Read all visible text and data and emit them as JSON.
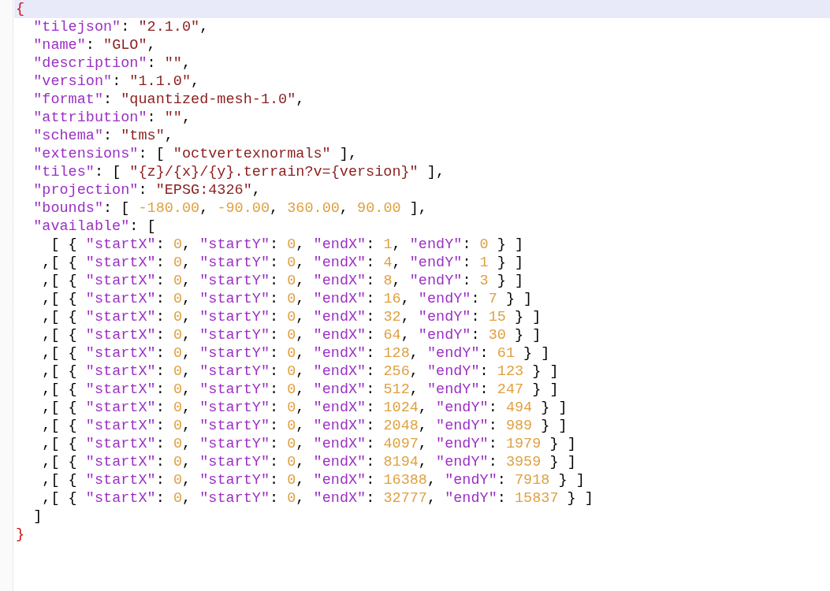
{
  "editor": {
    "lines": [
      {
        "current": true,
        "tokens": [
          {
            "kind": "brace",
            "text": "{"
          }
        ]
      },
      {
        "current": false,
        "tokens": [
          {
            "kind": "key",
            "text": "  \"tilejson\""
          },
          {
            "kind": "punct",
            "text": ": "
          },
          {
            "kind": "string",
            "text": "\"2.1.0\""
          },
          {
            "kind": "punct",
            "text": ","
          }
        ]
      },
      {
        "current": false,
        "tokens": [
          {
            "kind": "key",
            "text": "  \"name\""
          },
          {
            "kind": "punct",
            "text": ": "
          },
          {
            "kind": "string",
            "text": "\"GLO\""
          },
          {
            "kind": "punct",
            "text": ","
          }
        ]
      },
      {
        "current": false,
        "tokens": [
          {
            "kind": "key",
            "text": "  \"description\""
          },
          {
            "kind": "punct",
            "text": ": "
          },
          {
            "kind": "string",
            "text": "\"\""
          },
          {
            "kind": "punct",
            "text": ","
          }
        ]
      },
      {
        "current": false,
        "tokens": [
          {
            "kind": "key",
            "text": "  \"version\""
          },
          {
            "kind": "punct",
            "text": ": "
          },
          {
            "kind": "string",
            "text": "\"1.1.0\""
          },
          {
            "kind": "punct",
            "text": ","
          }
        ]
      },
      {
        "current": false,
        "tokens": [
          {
            "kind": "key",
            "text": "  \"format\""
          },
          {
            "kind": "punct",
            "text": ": "
          },
          {
            "kind": "string",
            "text": "\"quantized-mesh-1.0\""
          },
          {
            "kind": "punct",
            "text": ","
          }
        ]
      },
      {
        "current": false,
        "tokens": [
          {
            "kind": "key",
            "text": "  \"attribution\""
          },
          {
            "kind": "punct",
            "text": ": "
          },
          {
            "kind": "string",
            "text": "\"\""
          },
          {
            "kind": "punct",
            "text": ","
          }
        ]
      },
      {
        "current": false,
        "tokens": [
          {
            "kind": "key",
            "text": "  \"schema\""
          },
          {
            "kind": "punct",
            "text": ": "
          },
          {
            "kind": "string",
            "text": "\"tms\""
          },
          {
            "kind": "punct",
            "text": ","
          }
        ]
      },
      {
        "current": false,
        "tokens": [
          {
            "kind": "key",
            "text": "  \"extensions\""
          },
          {
            "kind": "punct",
            "text": ": [ "
          },
          {
            "kind": "string",
            "text": "\"octvertexnormals\""
          },
          {
            "kind": "punct",
            "text": " ],"
          }
        ]
      },
      {
        "current": false,
        "tokens": [
          {
            "kind": "key",
            "text": "  \"tiles\""
          },
          {
            "kind": "punct",
            "text": ": [ "
          },
          {
            "kind": "string",
            "text": "\"{z}/{x}/{y}.terrain?v={version}\""
          },
          {
            "kind": "punct",
            "text": " ],"
          }
        ]
      },
      {
        "current": false,
        "tokens": [
          {
            "kind": "key",
            "text": "  \"projection\""
          },
          {
            "kind": "punct",
            "text": ": "
          },
          {
            "kind": "string",
            "text": "\"EPSG:4326\""
          },
          {
            "kind": "punct",
            "text": ","
          }
        ]
      },
      {
        "current": false,
        "tokens": [
          {
            "kind": "key",
            "text": "  \"bounds\""
          },
          {
            "kind": "punct",
            "text": ": [ "
          },
          {
            "kind": "number",
            "text": "-180.00"
          },
          {
            "kind": "punct",
            "text": ", "
          },
          {
            "kind": "number",
            "text": "-90.00"
          },
          {
            "kind": "punct",
            "text": ", "
          },
          {
            "kind": "number",
            "text": "360.00"
          },
          {
            "kind": "punct",
            "text": ", "
          },
          {
            "kind": "number",
            "text": "90.00"
          },
          {
            "kind": "punct",
            "text": " ],"
          }
        ]
      },
      {
        "current": false,
        "tokens": [
          {
            "kind": "key",
            "text": "  \"available\""
          },
          {
            "kind": "punct",
            "text": ": ["
          }
        ]
      },
      {
        "current": false,
        "tokens": [
          {
            "kind": "punct",
            "text": "    [ { "
          },
          {
            "kind": "key",
            "text": "\"startX\""
          },
          {
            "kind": "punct",
            "text": ": "
          },
          {
            "kind": "number",
            "text": "0"
          },
          {
            "kind": "punct",
            "text": ", "
          },
          {
            "kind": "key",
            "text": "\"startY\""
          },
          {
            "kind": "punct",
            "text": ": "
          },
          {
            "kind": "number",
            "text": "0"
          },
          {
            "kind": "punct",
            "text": ", "
          },
          {
            "kind": "key",
            "text": "\"endX\""
          },
          {
            "kind": "punct",
            "text": ": "
          },
          {
            "kind": "number",
            "text": "1"
          },
          {
            "kind": "punct",
            "text": ", "
          },
          {
            "kind": "key",
            "text": "\"endY\""
          },
          {
            "kind": "punct",
            "text": ": "
          },
          {
            "kind": "number",
            "text": "0"
          },
          {
            "kind": "punct",
            "text": " } ]"
          }
        ]
      },
      {
        "current": false,
        "tokens": [
          {
            "kind": "punct",
            "text": "   ,[ { "
          },
          {
            "kind": "key",
            "text": "\"startX\""
          },
          {
            "kind": "punct",
            "text": ": "
          },
          {
            "kind": "number",
            "text": "0"
          },
          {
            "kind": "punct",
            "text": ", "
          },
          {
            "kind": "key",
            "text": "\"startY\""
          },
          {
            "kind": "punct",
            "text": ": "
          },
          {
            "kind": "number",
            "text": "0"
          },
          {
            "kind": "punct",
            "text": ", "
          },
          {
            "kind": "key",
            "text": "\"endX\""
          },
          {
            "kind": "punct",
            "text": ": "
          },
          {
            "kind": "number",
            "text": "4"
          },
          {
            "kind": "punct",
            "text": ", "
          },
          {
            "kind": "key",
            "text": "\"endY\""
          },
          {
            "kind": "punct",
            "text": ": "
          },
          {
            "kind": "number",
            "text": "1"
          },
          {
            "kind": "punct",
            "text": " } ]"
          }
        ]
      },
      {
        "current": false,
        "tokens": [
          {
            "kind": "punct",
            "text": "   ,[ { "
          },
          {
            "kind": "key",
            "text": "\"startX\""
          },
          {
            "kind": "punct",
            "text": ": "
          },
          {
            "kind": "number",
            "text": "0"
          },
          {
            "kind": "punct",
            "text": ", "
          },
          {
            "kind": "key",
            "text": "\"startY\""
          },
          {
            "kind": "punct",
            "text": ": "
          },
          {
            "kind": "number",
            "text": "0"
          },
          {
            "kind": "punct",
            "text": ", "
          },
          {
            "kind": "key",
            "text": "\"endX\""
          },
          {
            "kind": "punct",
            "text": ": "
          },
          {
            "kind": "number",
            "text": "8"
          },
          {
            "kind": "punct",
            "text": ", "
          },
          {
            "kind": "key",
            "text": "\"endY\""
          },
          {
            "kind": "punct",
            "text": ": "
          },
          {
            "kind": "number",
            "text": "3"
          },
          {
            "kind": "punct",
            "text": " } ]"
          }
        ]
      },
      {
        "current": false,
        "tokens": [
          {
            "kind": "punct",
            "text": "   ,[ { "
          },
          {
            "kind": "key",
            "text": "\"startX\""
          },
          {
            "kind": "punct",
            "text": ": "
          },
          {
            "kind": "number",
            "text": "0"
          },
          {
            "kind": "punct",
            "text": ", "
          },
          {
            "kind": "key",
            "text": "\"startY\""
          },
          {
            "kind": "punct",
            "text": ": "
          },
          {
            "kind": "number",
            "text": "0"
          },
          {
            "kind": "punct",
            "text": ", "
          },
          {
            "kind": "key",
            "text": "\"endX\""
          },
          {
            "kind": "punct",
            "text": ": "
          },
          {
            "kind": "number",
            "text": "16"
          },
          {
            "kind": "punct",
            "text": ", "
          },
          {
            "kind": "key",
            "text": "\"endY\""
          },
          {
            "kind": "punct",
            "text": ": "
          },
          {
            "kind": "number",
            "text": "7"
          },
          {
            "kind": "punct",
            "text": " } ]"
          }
        ]
      },
      {
        "current": false,
        "tokens": [
          {
            "kind": "punct",
            "text": "   ,[ { "
          },
          {
            "kind": "key",
            "text": "\"startX\""
          },
          {
            "kind": "punct",
            "text": ": "
          },
          {
            "kind": "number",
            "text": "0"
          },
          {
            "kind": "punct",
            "text": ", "
          },
          {
            "kind": "key",
            "text": "\"startY\""
          },
          {
            "kind": "punct",
            "text": ": "
          },
          {
            "kind": "number",
            "text": "0"
          },
          {
            "kind": "punct",
            "text": ", "
          },
          {
            "kind": "key",
            "text": "\"endX\""
          },
          {
            "kind": "punct",
            "text": ": "
          },
          {
            "kind": "number",
            "text": "32"
          },
          {
            "kind": "punct",
            "text": ", "
          },
          {
            "kind": "key",
            "text": "\"endY\""
          },
          {
            "kind": "punct",
            "text": ": "
          },
          {
            "kind": "number",
            "text": "15"
          },
          {
            "kind": "punct",
            "text": " } ]"
          }
        ]
      },
      {
        "current": false,
        "tokens": [
          {
            "kind": "punct",
            "text": "   ,[ { "
          },
          {
            "kind": "key",
            "text": "\"startX\""
          },
          {
            "kind": "punct",
            "text": ": "
          },
          {
            "kind": "number",
            "text": "0"
          },
          {
            "kind": "punct",
            "text": ", "
          },
          {
            "kind": "key",
            "text": "\"startY\""
          },
          {
            "kind": "punct",
            "text": ": "
          },
          {
            "kind": "number",
            "text": "0"
          },
          {
            "kind": "punct",
            "text": ", "
          },
          {
            "kind": "key",
            "text": "\"endX\""
          },
          {
            "kind": "punct",
            "text": ": "
          },
          {
            "kind": "number",
            "text": "64"
          },
          {
            "kind": "punct",
            "text": ", "
          },
          {
            "kind": "key",
            "text": "\"endY\""
          },
          {
            "kind": "punct",
            "text": ": "
          },
          {
            "kind": "number",
            "text": "30"
          },
          {
            "kind": "punct",
            "text": " } ]"
          }
        ]
      },
      {
        "current": false,
        "tokens": [
          {
            "kind": "punct",
            "text": "   ,[ { "
          },
          {
            "kind": "key",
            "text": "\"startX\""
          },
          {
            "kind": "punct",
            "text": ": "
          },
          {
            "kind": "number",
            "text": "0"
          },
          {
            "kind": "punct",
            "text": ", "
          },
          {
            "kind": "key",
            "text": "\"startY\""
          },
          {
            "kind": "punct",
            "text": ": "
          },
          {
            "kind": "number",
            "text": "0"
          },
          {
            "kind": "punct",
            "text": ", "
          },
          {
            "kind": "key",
            "text": "\"endX\""
          },
          {
            "kind": "punct",
            "text": ": "
          },
          {
            "kind": "number",
            "text": "128"
          },
          {
            "kind": "punct",
            "text": ", "
          },
          {
            "kind": "key",
            "text": "\"endY\""
          },
          {
            "kind": "punct",
            "text": ": "
          },
          {
            "kind": "number",
            "text": "61"
          },
          {
            "kind": "punct",
            "text": " } ]"
          }
        ]
      },
      {
        "current": false,
        "tokens": [
          {
            "kind": "punct",
            "text": "   ,[ { "
          },
          {
            "kind": "key",
            "text": "\"startX\""
          },
          {
            "kind": "punct",
            "text": ": "
          },
          {
            "kind": "number",
            "text": "0"
          },
          {
            "kind": "punct",
            "text": ", "
          },
          {
            "kind": "key",
            "text": "\"startY\""
          },
          {
            "kind": "punct",
            "text": ": "
          },
          {
            "kind": "number",
            "text": "0"
          },
          {
            "kind": "punct",
            "text": ", "
          },
          {
            "kind": "key",
            "text": "\"endX\""
          },
          {
            "kind": "punct",
            "text": ": "
          },
          {
            "kind": "number",
            "text": "256"
          },
          {
            "kind": "punct",
            "text": ", "
          },
          {
            "kind": "key",
            "text": "\"endY\""
          },
          {
            "kind": "punct",
            "text": ": "
          },
          {
            "kind": "number",
            "text": "123"
          },
          {
            "kind": "punct",
            "text": " } ]"
          }
        ]
      },
      {
        "current": false,
        "tokens": [
          {
            "kind": "punct",
            "text": "   ,[ { "
          },
          {
            "kind": "key",
            "text": "\"startX\""
          },
          {
            "kind": "punct",
            "text": ": "
          },
          {
            "kind": "number",
            "text": "0"
          },
          {
            "kind": "punct",
            "text": ", "
          },
          {
            "kind": "key",
            "text": "\"startY\""
          },
          {
            "kind": "punct",
            "text": ": "
          },
          {
            "kind": "number",
            "text": "0"
          },
          {
            "kind": "punct",
            "text": ", "
          },
          {
            "kind": "key",
            "text": "\"endX\""
          },
          {
            "kind": "punct",
            "text": ": "
          },
          {
            "kind": "number",
            "text": "512"
          },
          {
            "kind": "punct",
            "text": ", "
          },
          {
            "kind": "key",
            "text": "\"endY\""
          },
          {
            "kind": "punct",
            "text": ": "
          },
          {
            "kind": "number",
            "text": "247"
          },
          {
            "kind": "punct",
            "text": " } ]"
          }
        ]
      },
      {
        "current": false,
        "tokens": [
          {
            "kind": "punct",
            "text": "   ,[ { "
          },
          {
            "kind": "key",
            "text": "\"startX\""
          },
          {
            "kind": "punct",
            "text": ": "
          },
          {
            "kind": "number",
            "text": "0"
          },
          {
            "kind": "punct",
            "text": ", "
          },
          {
            "kind": "key",
            "text": "\"startY\""
          },
          {
            "kind": "punct",
            "text": ": "
          },
          {
            "kind": "number",
            "text": "0"
          },
          {
            "kind": "punct",
            "text": ", "
          },
          {
            "kind": "key",
            "text": "\"endX\""
          },
          {
            "kind": "punct",
            "text": ": "
          },
          {
            "kind": "number",
            "text": "1024"
          },
          {
            "kind": "punct",
            "text": ", "
          },
          {
            "kind": "key",
            "text": "\"endY\""
          },
          {
            "kind": "punct",
            "text": ": "
          },
          {
            "kind": "number",
            "text": "494"
          },
          {
            "kind": "punct",
            "text": " } ]"
          }
        ]
      },
      {
        "current": false,
        "tokens": [
          {
            "kind": "punct",
            "text": "   ,[ { "
          },
          {
            "kind": "key",
            "text": "\"startX\""
          },
          {
            "kind": "punct",
            "text": ": "
          },
          {
            "kind": "number",
            "text": "0"
          },
          {
            "kind": "punct",
            "text": ", "
          },
          {
            "kind": "key",
            "text": "\"startY\""
          },
          {
            "kind": "punct",
            "text": ": "
          },
          {
            "kind": "number",
            "text": "0"
          },
          {
            "kind": "punct",
            "text": ", "
          },
          {
            "kind": "key",
            "text": "\"endX\""
          },
          {
            "kind": "punct",
            "text": ": "
          },
          {
            "kind": "number",
            "text": "2048"
          },
          {
            "kind": "punct",
            "text": ", "
          },
          {
            "kind": "key",
            "text": "\"endY\""
          },
          {
            "kind": "punct",
            "text": ": "
          },
          {
            "kind": "number",
            "text": "989"
          },
          {
            "kind": "punct",
            "text": " } ]"
          }
        ]
      },
      {
        "current": false,
        "tokens": [
          {
            "kind": "punct",
            "text": "   ,[ { "
          },
          {
            "kind": "key",
            "text": "\"startX\""
          },
          {
            "kind": "punct",
            "text": ": "
          },
          {
            "kind": "number",
            "text": "0"
          },
          {
            "kind": "punct",
            "text": ", "
          },
          {
            "kind": "key",
            "text": "\"startY\""
          },
          {
            "kind": "punct",
            "text": ": "
          },
          {
            "kind": "number",
            "text": "0"
          },
          {
            "kind": "punct",
            "text": ", "
          },
          {
            "kind": "key",
            "text": "\"endX\""
          },
          {
            "kind": "punct",
            "text": ": "
          },
          {
            "kind": "number",
            "text": "4097"
          },
          {
            "kind": "punct",
            "text": ", "
          },
          {
            "kind": "key",
            "text": "\"endY\""
          },
          {
            "kind": "punct",
            "text": ": "
          },
          {
            "kind": "number",
            "text": "1979"
          },
          {
            "kind": "punct",
            "text": " } ]"
          }
        ]
      },
      {
        "current": false,
        "tokens": [
          {
            "kind": "punct",
            "text": "   ,[ { "
          },
          {
            "kind": "key",
            "text": "\"startX\""
          },
          {
            "kind": "punct",
            "text": ": "
          },
          {
            "kind": "number",
            "text": "0"
          },
          {
            "kind": "punct",
            "text": ", "
          },
          {
            "kind": "key",
            "text": "\"startY\""
          },
          {
            "kind": "punct",
            "text": ": "
          },
          {
            "kind": "number",
            "text": "0"
          },
          {
            "kind": "punct",
            "text": ", "
          },
          {
            "kind": "key",
            "text": "\"endX\""
          },
          {
            "kind": "punct",
            "text": ": "
          },
          {
            "kind": "number",
            "text": "8194"
          },
          {
            "kind": "punct",
            "text": ", "
          },
          {
            "kind": "key",
            "text": "\"endY\""
          },
          {
            "kind": "punct",
            "text": ": "
          },
          {
            "kind": "number",
            "text": "3959"
          },
          {
            "kind": "punct",
            "text": " } ]"
          }
        ]
      },
      {
        "current": false,
        "tokens": [
          {
            "kind": "punct",
            "text": "   ,[ { "
          },
          {
            "kind": "key",
            "text": "\"startX\""
          },
          {
            "kind": "punct",
            "text": ": "
          },
          {
            "kind": "number",
            "text": "0"
          },
          {
            "kind": "punct",
            "text": ", "
          },
          {
            "kind": "key",
            "text": "\"startY\""
          },
          {
            "kind": "punct",
            "text": ": "
          },
          {
            "kind": "number",
            "text": "0"
          },
          {
            "kind": "punct",
            "text": ", "
          },
          {
            "kind": "key",
            "text": "\"endX\""
          },
          {
            "kind": "punct",
            "text": ": "
          },
          {
            "kind": "number",
            "text": "16388"
          },
          {
            "kind": "punct",
            "text": ", "
          },
          {
            "kind": "key",
            "text": "\"endY\""
          },
          {
            "kind": "punct",
            "text": ": "
          },
          {
            "kind": "number",
            "text": "7918"
          },
          {
            "kind": "punct",
            "text": " } ]"
          }
        ]
      },
      {
        "current": false,
        "tokens": [
          {
            "kind": "punct",
            "text": "   ,[ { "
          },
          {
            "kind": "key",
            "text": "\"startX\""
          },
          {
            "kind": "punct",
            "text": ": "
          },
          {
            "kind": "number",
            "text": "0"
          },
          {
            "kind": "punct",
            "text": ", "
          },
          {
            "kind": "key",
            "text": "\"startY\""
          },
          {
            "kind": "punct",
            "text": ": "
          },
          {
            "kind": "number",
            "text": "0"
          },
          {
            "kind": "punct",
            "text": ", "
          },
          {
            "kind": "key",
            "text": "\"endX\""
          },
          {
            "kind": "punct",
            "text": ": "
          },
          {
            "kind": "number",
            "text": "32777"
          },
          {
            "kind": "punct",
            "text": ", "
          },
          {
            "kind": "key",
            "text": "\"endY\""
          },
          {
            "kind": "punct",
            "text": ": "
          },
          {
            "kind": "number",
            "text": "15837"
          },
          {
            "kind": "punct",
            "text": " } ]"
          }
        ]
      },
      {
        "current": false,
        "tokens": [
          {
            "kind": "punct",
            "text": "  ]"
          }
        ]
      },
      {
        "current": false,
        "tokens": [
          {
            "kind": "brace",
            "text": "}"
          }
        ]
      }
    ]
  }
}
